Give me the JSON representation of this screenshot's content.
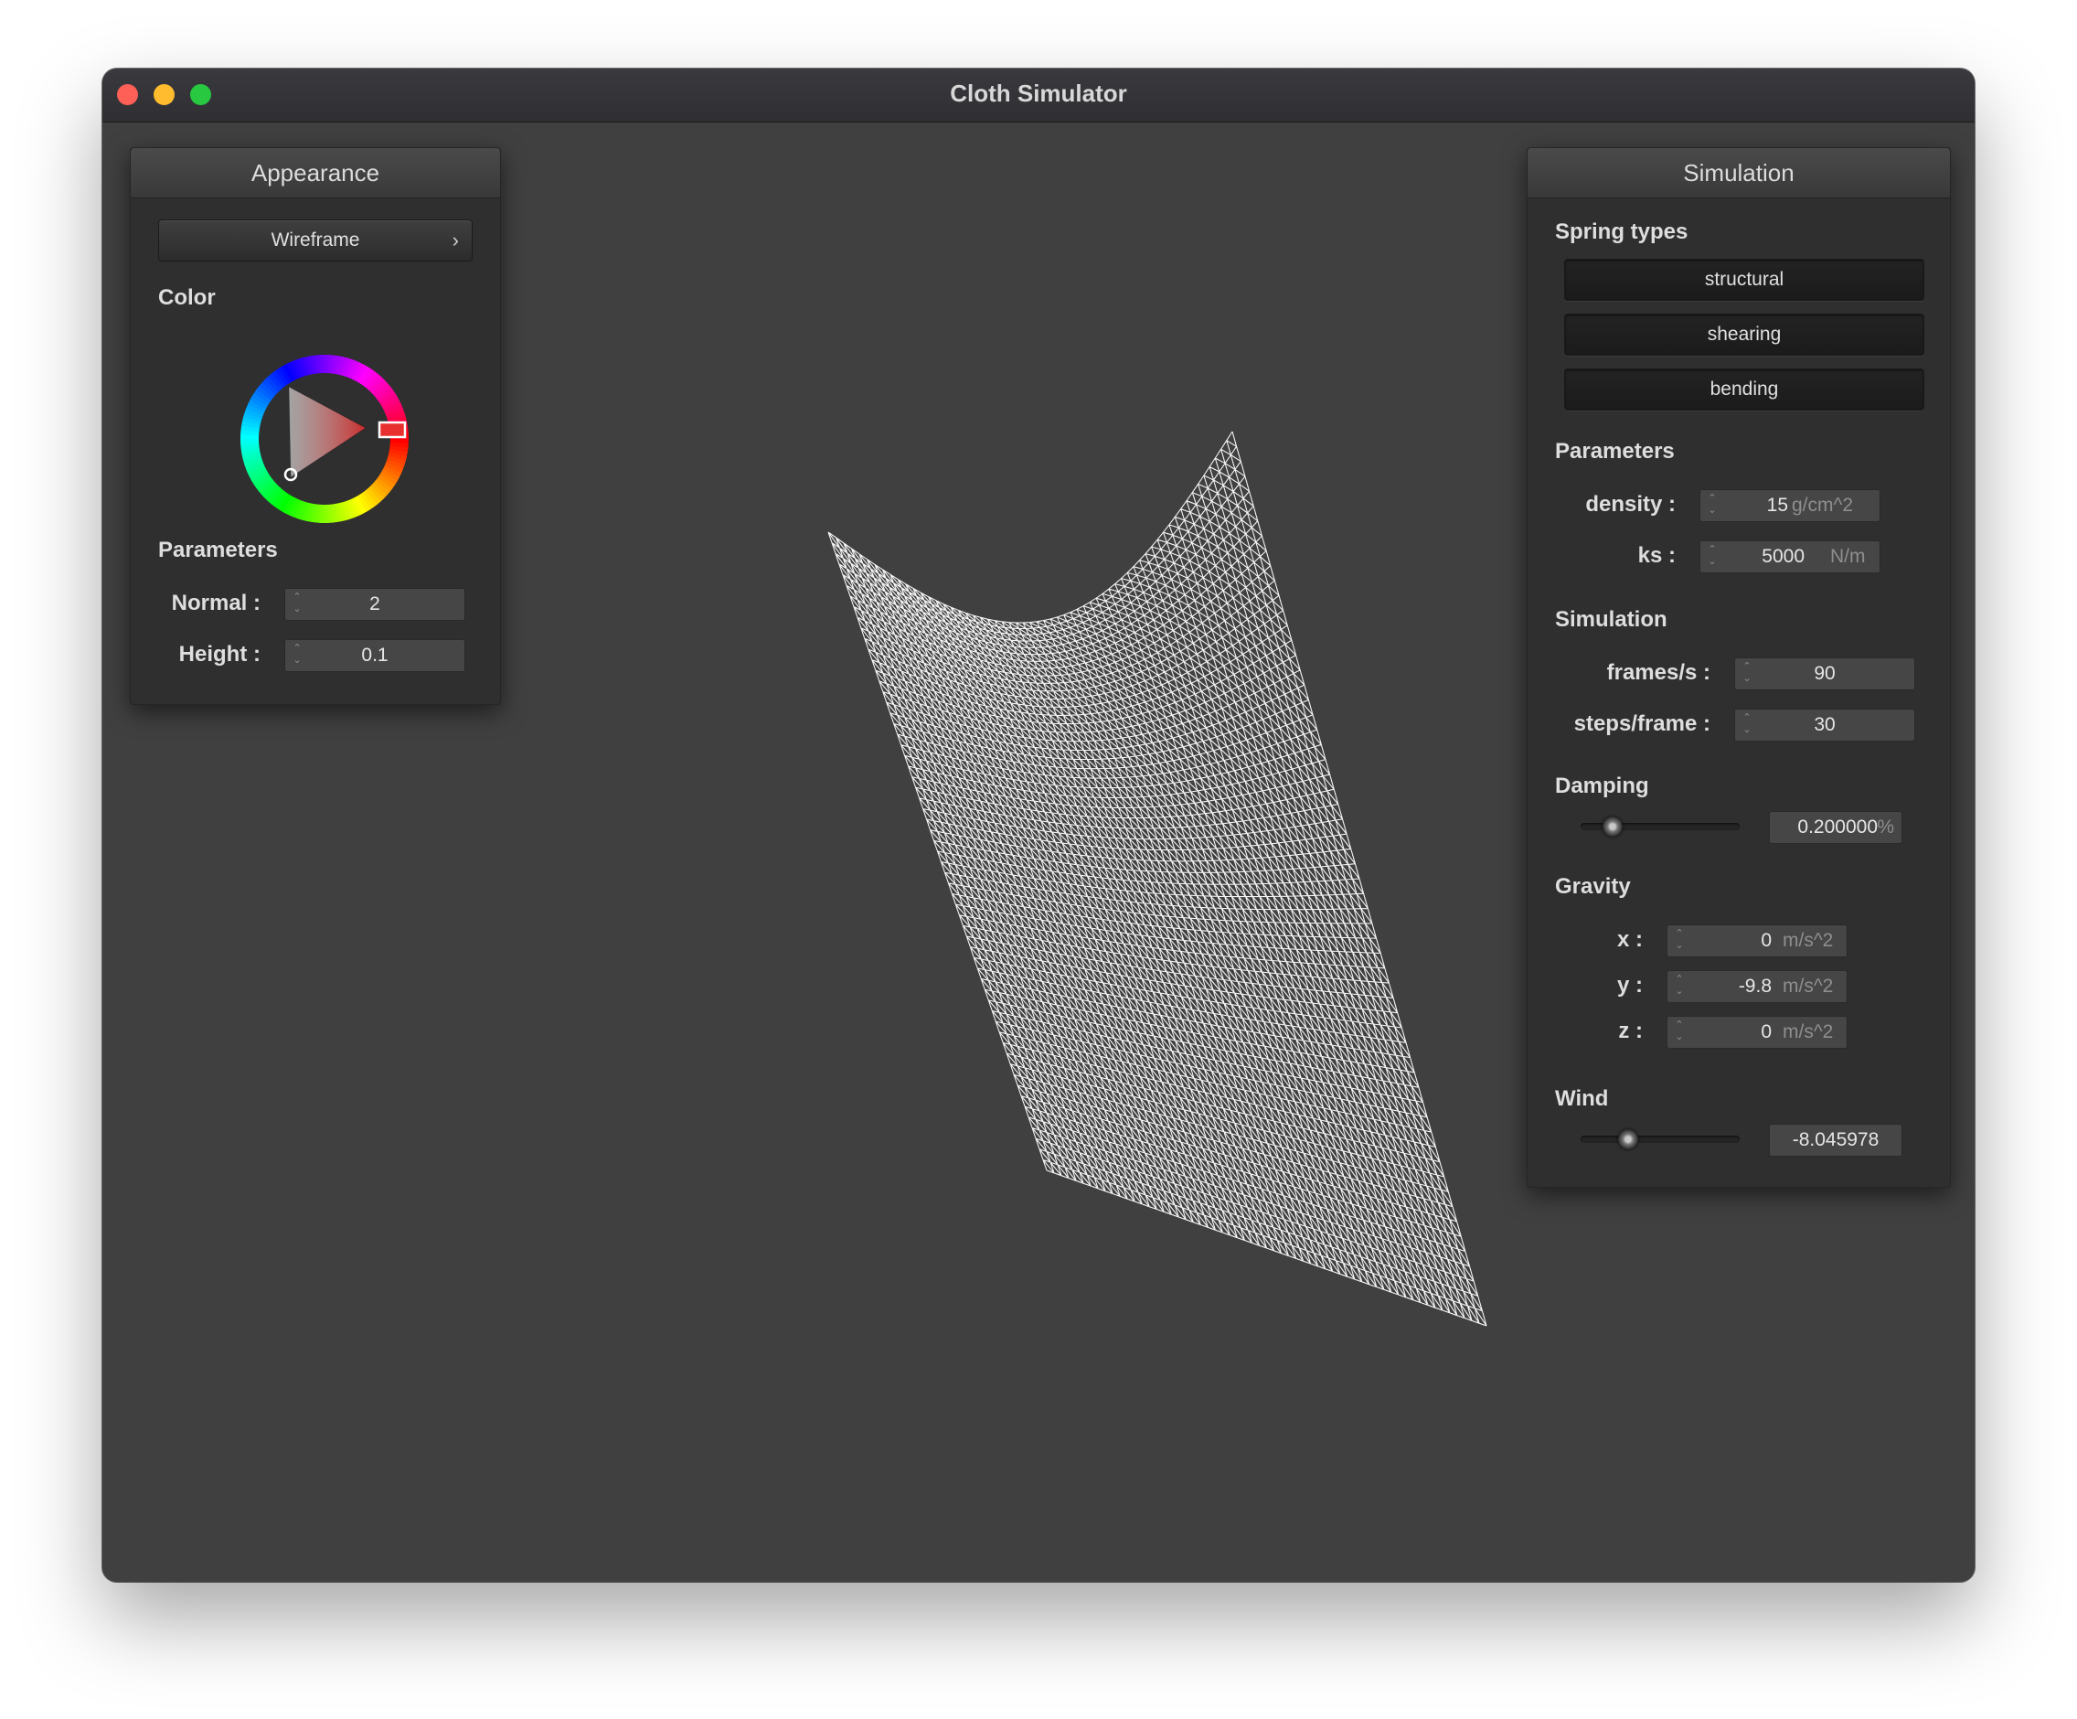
{
  "window": {
    "title": "Cloth Simulator"
  },
  "appearance": {
    "header": "Appearance",
    "shader": "Wireframe",
    "color_section": "Color",
    "selected_color": "#e83030",
    "params_section": "Parameters",
    "normal_label": "Normal :",
    "normal_value": "2",
    "height_label": "Height :",
    "height_value": "0.1"
  },
  "simulation": {
    "header": "Simulation",
    "spring_section": "Spring types",
    "springs": [
      "structural",
      "shearing",
      "bending"
    ],
    "params_section": "Parameters",
    "density_label": "density :",
    "density_value": "15",
    "density_unit": "g/cm^2",
    "ks_label": "ks :",
    "ks_value": "5000",
    "ks_unit": "N/m",
    "sim_section": "Simulation",
    "fps_label": "frames/s :",
    "fps_value": "90",
    "steps_label": "steps/frame :",
    "steps_value": "30",
    "damping_section": "Damping",
    "damping_value": "0.200000",
    "damping_unit": "%",
    "damping_slider_fraction": 0.2,
    "gravity_section": "Gravity",
    "gx_label": "x :",
    "gx_value": "0",
    "gy_label": "y :",
    "gy_value": "-9.8",
    "gz_label": "z :",
    "gz_value": "0",
    "gravity_unit": "m/s^2",
    "wind_section": "Wind",
    "wind_value": "-8.045978",
    "wind_slider_fraction": 0.3
  },
  "colors": {
    "background": "#404040",
    "mesh": "#ffffff",
    "panel": "#2f2f2f"
  }
}
